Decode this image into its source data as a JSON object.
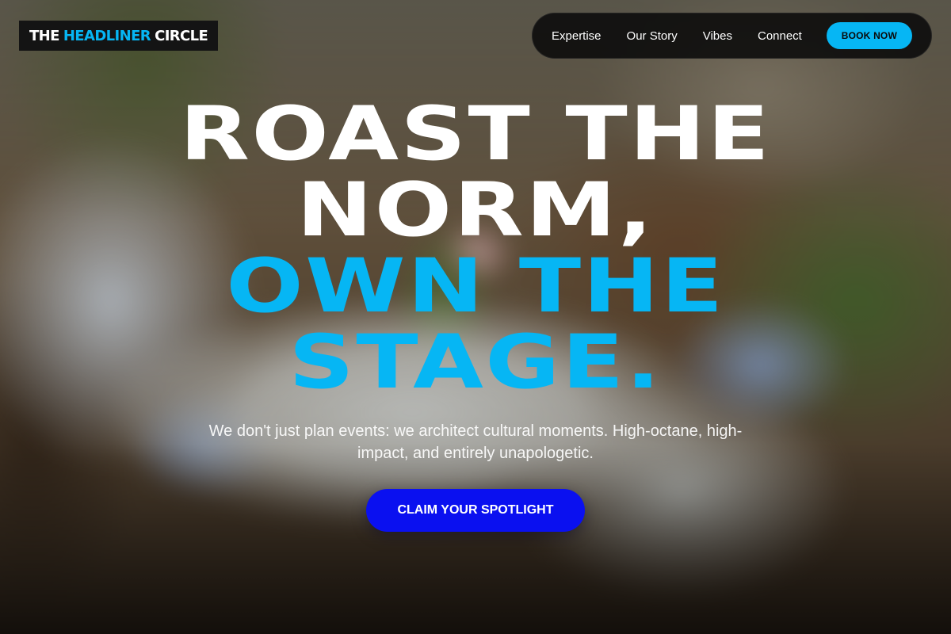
{
  "colors": {
    "accent_cyan": "#06b6f4",
    "cta_blue": "#0a10f0",
    "white": "#ffffff",
    "dark": "#141414"
  },
  "background": {
    "description_icon": "banquet-table-photo"
  },
  "header": {
    "logo": {
      "part1": "THE",
      "part2": "HEADLINER",
      "part3": "CIRCLE"
    },
    "nav": {
      "items": [
        {
          "label": "Expertise"
        },
        {
          "label": "Our Story"
        },
        {
          "label": "Vibes"
        },
        {
          "label": "Connect"
        }
      ],
      "cta_label": "BOOK NOW"
    }
  },
  "hero": {
    "title": {
      "line1": "ROAST THE",
      "line2": "NORM,",
      "line3": "OWN THE",
      "line4": "STAGE."
    },
    "subtitle": "We don't just plan events: we architect cultural moments. High-octane, high-impact, and entirely unapologetic.",
    "cta_label": "CLAIM YOUR SPOTLIGHT"
  }
}
